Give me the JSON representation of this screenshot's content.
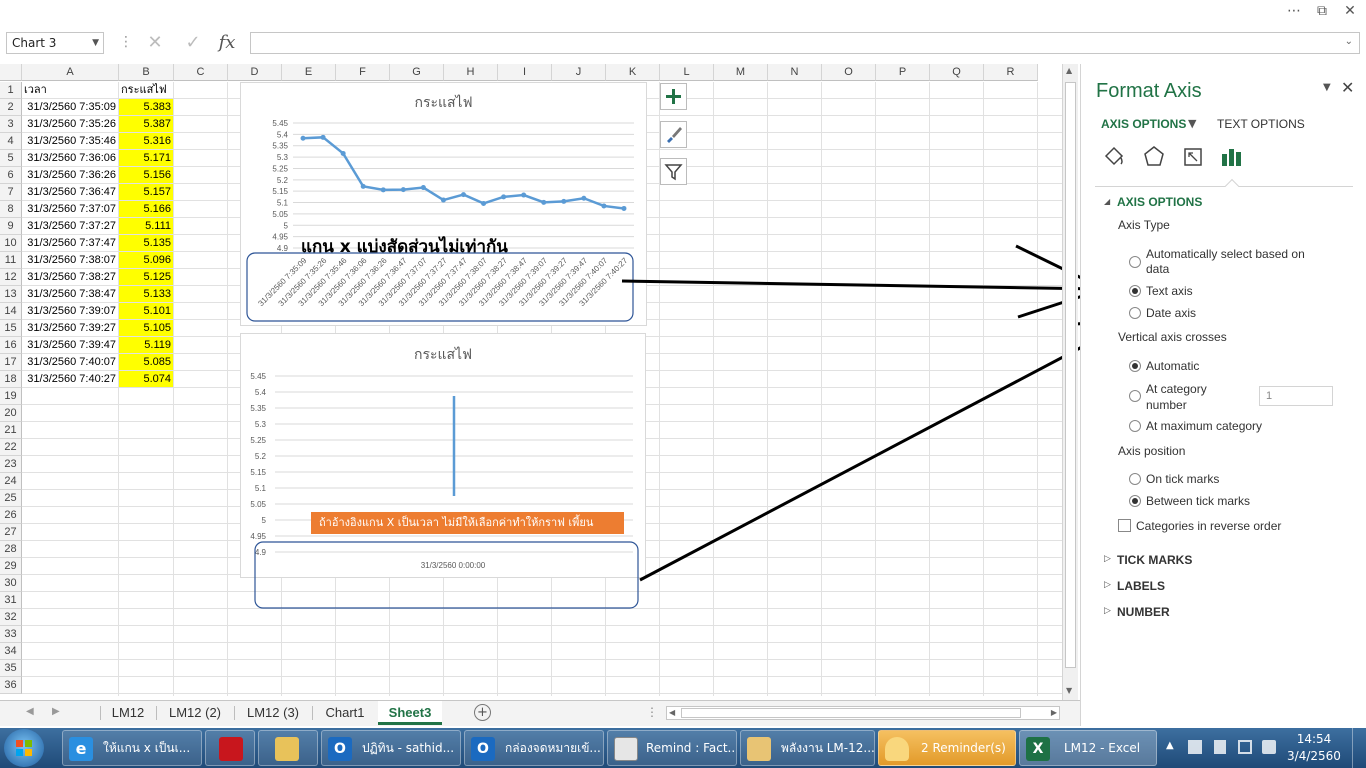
{
  "formula_bar": {
    "name_box": "Chart 3",
    "cancel_icon": "✕",
    "enter_icon": "✓",
    "fx_icon": "fx",
    "formula": ""
  },
  "columns": [
    "A",
    "B",
    "C",
    "D",
    "E",
    "F",
    "G",
    "H",
    "I",
    "J",
    "K",
    "L",
    "M",
    "N",
    "O",
    "P",
    "Q",
    "R"
  ],
  "rows": [
    "1",
    "2",
    "3",
    "4",
    "5",
    "6",
    "7",
    "8",
    "9",
    "10",
    "11",
    "12",
    "13",
    "14",
    "15",
    "16",
    "17",
    "18",
    "19",
    "20",
    "21",
    "22",
    "23",
    "24",
    "25",
    "26",
    "27",
    "28",
    "29",
    "30",
    "31",
    "32",
    "33",
    "34",
    "35",
    "36"
  ],
  "table": {
    "header_a": "เวลา",
    "header_b": "กระแสไฟ",
    "times": [
      "31/3/2560 7:35:09",
      "31/3/2560 7:35:26",
      "31/3/2560 7:35:46",
      "31/3/2560 7:36:06",
      "31/3/2560 7:36:26",
      "31/3/2560 7:36:47",
      "31/3/2560 7:37:07",
      "31/3/2560 7:37:27",
      "31/3/2560 7:37:47",
      "31/3/2560 7:38:07",
      "31/3/2560 7:38:27",
      "31/3/2560 7:38:47",
      "31/3/2560 7:39:07",
      "31/3/2560 7:39:27",
      "31/3/2560 7:39:47",
      "31/3/2560 7:40:07",
      "31/3/2560 7:40:27"
    ],
    "values": [
      "5.383",
      "5.387",
      "5.316",
      "5.171",
      "5.156",
      "5.157",
      "5.166",
      "5.111",
      "5.135",
      "5.096",
      "5.125",
      "5.133",
      "5.101",
      "5.105",
      "5.119",
      "5.085",
      "5.074"
    ]
  },
  "chart_data": [
    {
      "type": "line",
      "title": "กระแสไฟ",
      "x": [
        "31/3/2560 7:35:09",
        "31/3/2560 7:35:26",
        "31/3/2560 7:35:46",
        "31/3/2560 7:36:06",
        "31/3/2560 7:36:26",
        "31/3/2560 7:36:47",
        "31/3/2560 7:37:07",
        "31/3/2560 7:37:27",
        "31/3/2560 7:37:47",
        "31/3/2560 7:38:07",
        "31/3/2560 7:38:27",
        "31/3/2560 7:38:47",
        "31/3/2560 7:39:07",
        "31/3/2560 7:39:27",
        "31/3/2560 7:39:47",
        "31/3/2560 7:40:07",
        "31/3/2560 7:40:27"
      ],
      "values": [
        5.383,
        5.387,
        5.316,
        5.171,
        5.156,
        5.157,
        5.166,
        5.111,
        5.135,
        5.096,
        5.125,
        5.133,
        5.101,
        5.105,
        5.119,
        5.085,
        5.074
      ],
      "ylim": [
        4.9,
        5.45
      ],
      "yticks": [
        "5.45",
        "5.4",
        "5.35",
        "5.3",
        "5.25",
        "5.2",
        "5.15",
        "5.1",
        "5.05",
        "5",
        "4.95",
        "4.9"
      ],
      "color": "#5b9bd5",
      "annotation": "แกน x แบ่งสัดส่วนไม่เท่ากัน"
    },
    {
      "type": "line",
      "title": "กระแสไฟ",
      "x": [
        "31/3/2560 0:00:00"
      ],
      "ylim": [
        4.9,
        5.45
      ],
      "yticks": [
        "5.45",
        "5.4",
        "5.35",
        "5.3",
        "5.25",
        "5.2",
        "5.15",
        "5.1",
        "5.05",
        "5",
        "4.95",
        "4.9"
      ],
      "color": "#5b9bd5",
      "annotation": "ถ้าอ้างอิงแกน X เป็นเวลา ไม่มีให้เลือกค่าทำให้กราฟ เพี้ยน"
    }
  ],
  "sheet_tabs": [
    "LM12",
    "LM12 (2)",
    "LM12 (3)",
    "Chart1",
    "Sheet3"
  ],
  "active_tab": "Sheet3",
  "pane": {
    "title": "Format Axis",
    "tab_axis_options": "AXIS OPTIONS",
    "tab_text_options": "TEXT OPTIONS",
    "section_axis_options": "AXIS OPTIONS",
    "axis_type_label": "Axis Type",
    "auto_select_line1": "Automatically select based on",
    "auto_select_line2": "data",
    "text_axis": "Text axis",
    "date_axis": "Date axis",
    "vertical_crosses_label": "Vertical axis crosses",
    "automatic": "Automatic",
    "at_category_line1": "At category",
    "at_category_line2": "number",
    "at_category_value": "1",
    "at_max_category": "At maximum category",
    "axis_position_label": "Axis position",
    "on_tick_marks": "On tick marks",
    "between_tick_marks": "Between tick marks",
    "reverse_order": "Categories in reverse order",
    "tick_marks": "TICK MARKS",
    "labels": "LABELS",
    "number": "NUMBER"
  },
  "taskbar": {
    "items": [
      "ให้แกน x เป็นเ...",
      "",
      "",
      "ปฏิทิน - sathid...",
      "กล่องจดหมายเข้...",
      "Remind : Fact...",
      "พลังงาน LM-12...",
      "2 Reminder(s)",
      "LM12 - Excel"
    ],
    "time": "14:54",
    "date": "3/4/2560"
  }
}
